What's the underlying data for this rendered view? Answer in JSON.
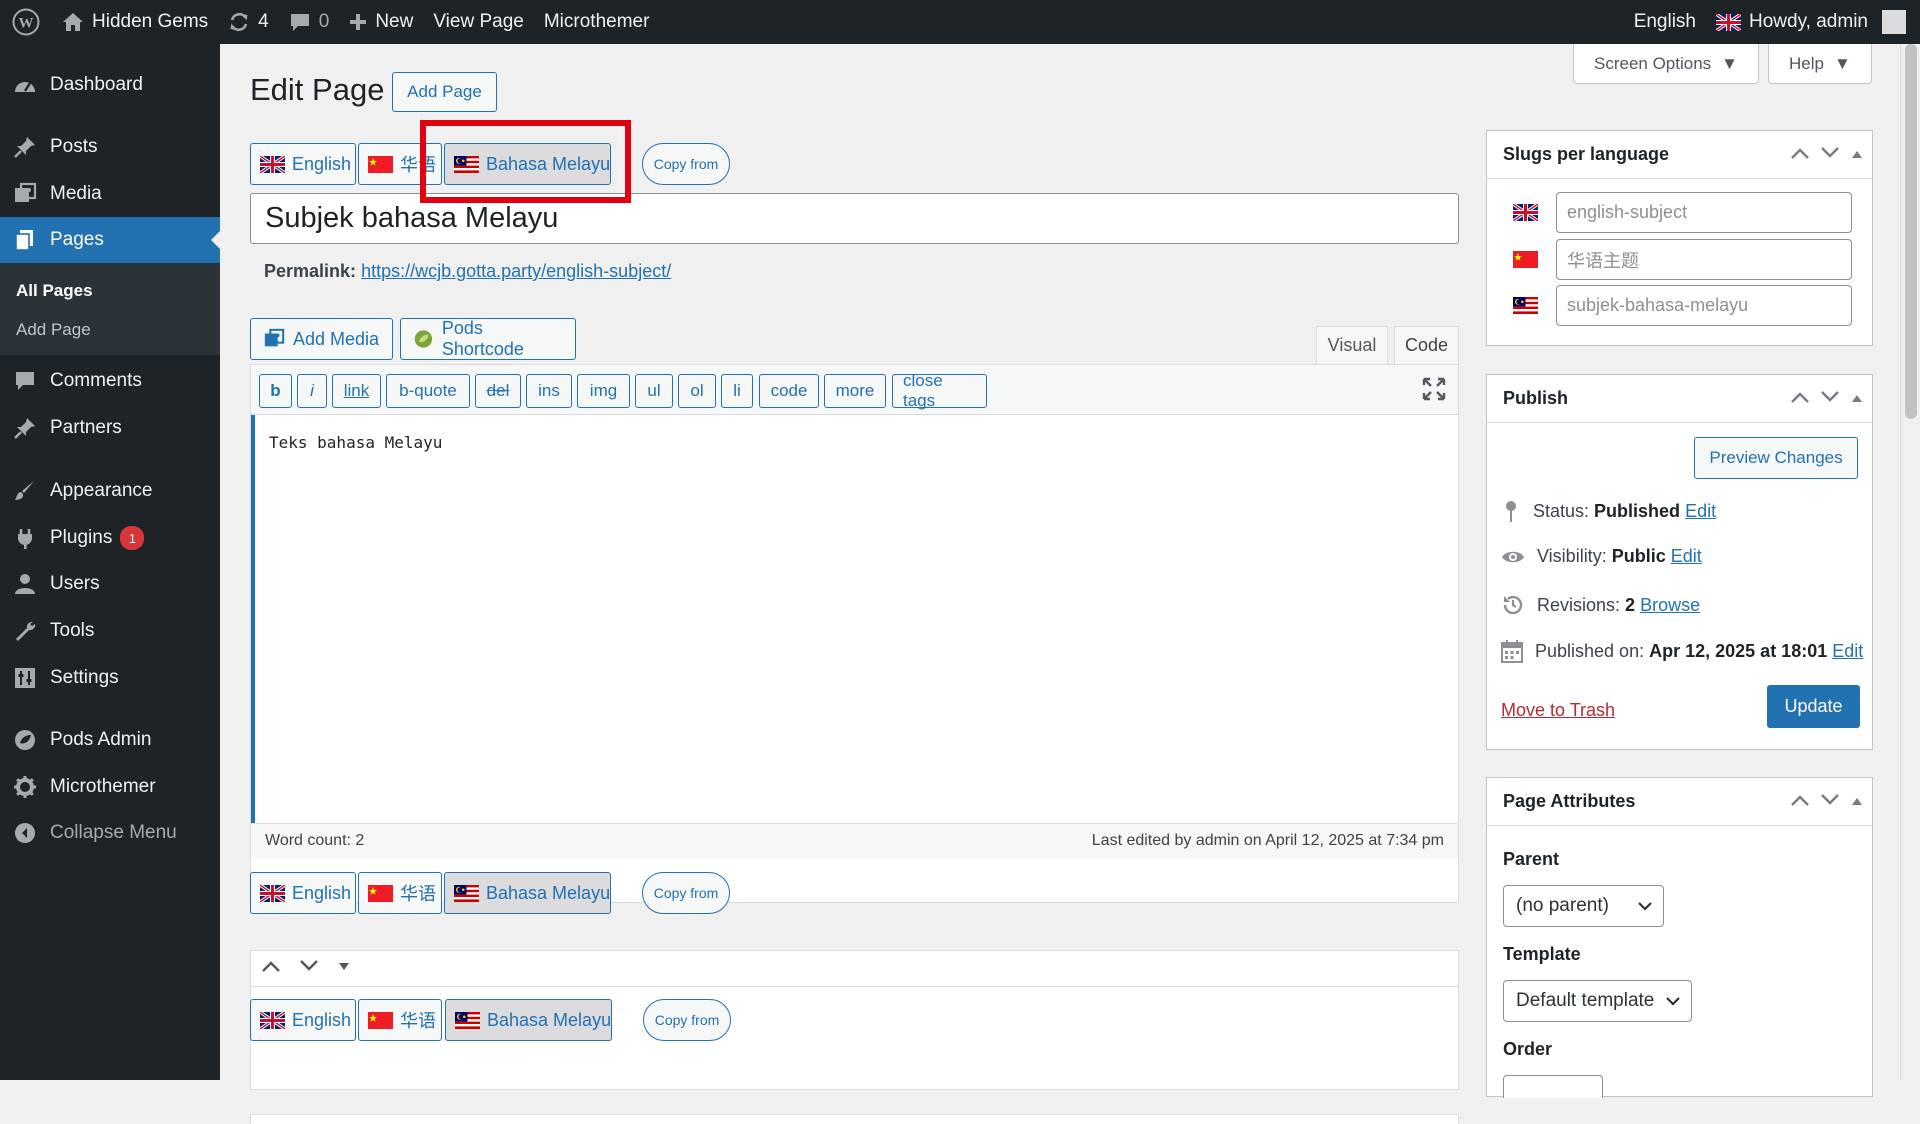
{
  "adminbar": {
    "site_name": "Hidden Gems",
    "updates_count": "4",
    "comments_count": "0",
    "new_label": "New",
    "view_page_label": "View Page",
    "microthemer_label": "Microthemer",
    "language_label": "English",
    "howdy_label": "Howdy, admin"
  },
  "sidebar": {
    "dashboard": "Dashboard",
    "posts": "Posts",
    "media": "Media",
    "pages": "Pages",
    "all_pages": "All Pages",
    "add_page": "Add Page",
    "comments": "Comments",
    "partners": "Partners",
    "appearance": "Appearance",
    "plugins": "Plugins",
    "plugins_badge": "1",
    "users": "Users",
    "tools": "Tools",
    "settings": "Settings",
    "pods_admin": "Pods Admin",
    "microthemer": "Microthemer",
    "collapse": "Collapse Menu"
  },
  "header": {
    "title": "Edit Page",
    "add_page_button": "Add Page",
    "screen_options": "Screen Options",
    "help": "Help"
  },
  "languages": {
    "english": "English",
    "chinese": "华语",
    "malay": "Bahasa Melayu",
    "copy_from": "Copy from"
  },
  "post": {
    "title": "Subjek bahasa Melayu",
    "permalink_label": "Permalink:",
    "permalink_url": "https://wcjb.gotta.party/english-subject/"
  },
  "editor": {
    "add_media": "Add Media",
    "pods_shortcode": "Pods Shortcode",
    "tab_visual": "Visual",
    "tab_code": "Code",
    "quicktags": [
      "b",
      "i",
      "link",
      "b-quote",
      "del",
      "ins",
      "img",
      "ul",
      "ol",
      "li",
      "code",
      "more",
      "close tags"
    ],
    "content": "Teks bahasa Melayu",
    "word_count": "Word count: 2",
    "last_edited": "Last edited by admin on April 12, 2025 at 7:34 pm"
  },
  "slugs": {
    "title": "Slugs per language",
    "english_placeholder": "english-subject",
    "chinese_placeholder": "华语主题",
    "malay_placeholder": "subjek-bahasa-melayu"
  },
  "publish": {
    "title": "Publish",
    "preview": "Preview Changes",
    "status_label": "Status:",
    "status_value": "Published",
    "visibility_label": "Visibility:",
    "visibility_value": "Public",
    "revisions_label": "Revisions:",
    "revisions_value": "2",
    "browse": "Browse",
    "published_label": "Published on:",
    "published_value": "Apr 12, 2025 at 18:01",
    "edit": "Edit",
    "trash": "Move to Trash",
    "update": "Update"
  },
  "attributes": {
    "title": "Page Attributes",
    "parent_label": "Parent",
    "parent_value": "(no parent)",
    "template_label": "Template",
    "template_value": "Default template",
    "order_label": "Order"
  },
  "colors": {
    "accent": "#2271b1",
    "sidebar_bg": "#1d2327",
    "highlight": "#e1000f",
    "badge": "#d63638"
  }
}
